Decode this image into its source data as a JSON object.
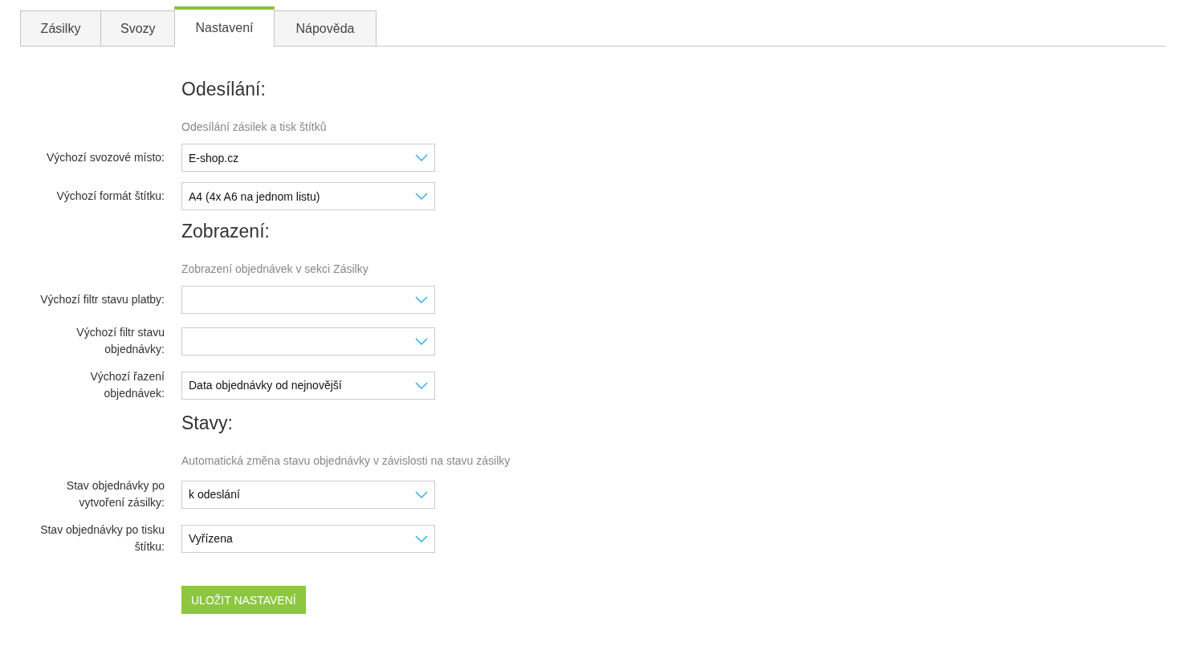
{
  "tabs": [
    {
      "label": "Zásilky",
      "selected": false
    },
    {
      "label": "Svozy",
      "selected": false
    },
    {
      "label": "Nastavení",
      "selected": true
    },
    {
      "label": "Nápověda",
      "selected": false
    }
  ],
  "sections": [
    {
      "heading": "Odesílání:",
      "subtitle": "Odesílání zásilek a tisk štítků",
      "fields": [
        {
          "label": "Výchozí svozové místo:",
          "value": "E-shop.cz"
        },
        {
          "label": "Výchozí formát štítku:",
          "value": "A4 (4x A6 na jednom listu)"
        }
      ]
    },
    {
      "heading": "Zobrazení:",
      "subtitle": "Zobrazení objednávek v sekci Zásilky",
      "fields": [
        {
          "label": "Výchozí filtr stavu platby:"
        },
        {
          "label": "Výchozí filtr stavu objednávky:"
        },
        {
          "label": "Výchozí řazení objednávek:",
          "value": "Data objednávky od nejnovější"
        }
      ]
    },
    {
      "heading": "Stavy:",
      "subtitle": "Automatická změna stavu objednávky v závislosti na stavu zásilky",
      "fields": [
        {
          "label": "Stav objednávky po vytvoření zásilky:",
          "value": "k odeslání"
        },
        {
          "label": "Stav objednávky po tisku štítku:",
          "value": "Vyřízena"
        }
      ]
    }
  ],
  "save_button": "ULOŽIT NASTAVENÍ"
}
